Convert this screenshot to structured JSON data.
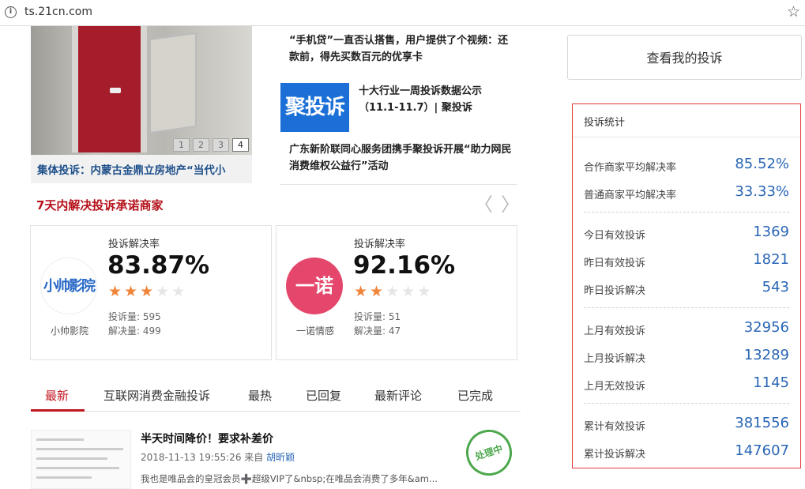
{
  "browser": {
    "url": "ts.21cn.com"
  },
  "slider": {
    "pages": [
      "1",
      "2",
      "3",
      "4"
    ],
    "active_page": "4",
    "caption": "集体投诉：内蒙古金鼎立房地产“当代小"
  },
  "news": {
    "item1": "“手机贷”一直否认搭售，用户提供了个视频：还款前，得先买数百元的优享卡",
    "logo_text": "聚投诉",
    "item2": "十大行业一周投诉数据公示（11.1-11.7）| 聚投诉",
    "item3": "广东新阶联同心服务团携手聚投诉开展“助力网民消费维权公益行”活动"
  },
  "merchants": {
    "title": "7天内解决投诉承诺商家",
    "cards": [
      {
        "name": "小帅影院",
        "logo_text": "小帅影院",
        "rate_label": "投诉解决率",
        "rate": "83.87%",
        "stars": 3,
        "complaints": "投诉量: 595",
        "resolved": "解决量: 499"
      },
      {
        "name": "一诺情感",
        "logo_text": "一诺",
        "rate_label": "投诉解决率",
        "rate": "92.16%",
        "stars": 2,
        "complaints": "投诉量: 51",
        "resolved": "解决量: 47"
      }
    ]
  },
  "tabs": [
    "最新",
    "互联网消费金融投诉",
    "最热",
    "已回复",
    "最新评论",
    "已完成"
  ],
  "post": {
    "title": "半天时间降价！要求补差价",
    "time": "2018-11-13 19:55:26",
    "from_label": "来自",
    "author": "胡昕颖",
    "desc": "我也是唯品会的皇冠会员➕超级VIP了&nbsp;在唯品会消费了多年&am...",
    "status": "处理中"
  },
  "sidebar": {
    "view_button": "查看我的投诉",
    "stats_title": "投诉统计",
    "groups": [
      [
        {
          "label": "合作商家平均解决率",
          "value": "85.52%"
        },
        {
          "label": "普通商家平均解决率",
          "value": "33.33%"
        }
      ],
      [
        {
          "label": "今日有效投诉",
          "value": "1369"
        },
        {
          "label": "昨日有效投诉",
          "value": "1821"
        },
        {
          "label": "昨日投诉解决",
          "value": "543"
        }
      ],
      [
        {
          "label": "上月有效投诉",
          "value": "32956"
        },
        {
          "label": "上月投诉解决",
          "value": "13289"
        },
        {
          "label": "上月无效投诉",
          "value": "1145"
        }
      ],
      [
        {
          "label": "累计有效投诉",
          "value": "381556"
        },
        {
          "label": "累计投诉解决",
          "value": "147607"
        }
      ]
    ]
  },
  "colors": {
    "brand_red": "#c0171f",
    "link_blue": "#2a66b5",
    "star_orange": "#f0853a",
    "star_gray": "#e6e6e6"
  }
}
